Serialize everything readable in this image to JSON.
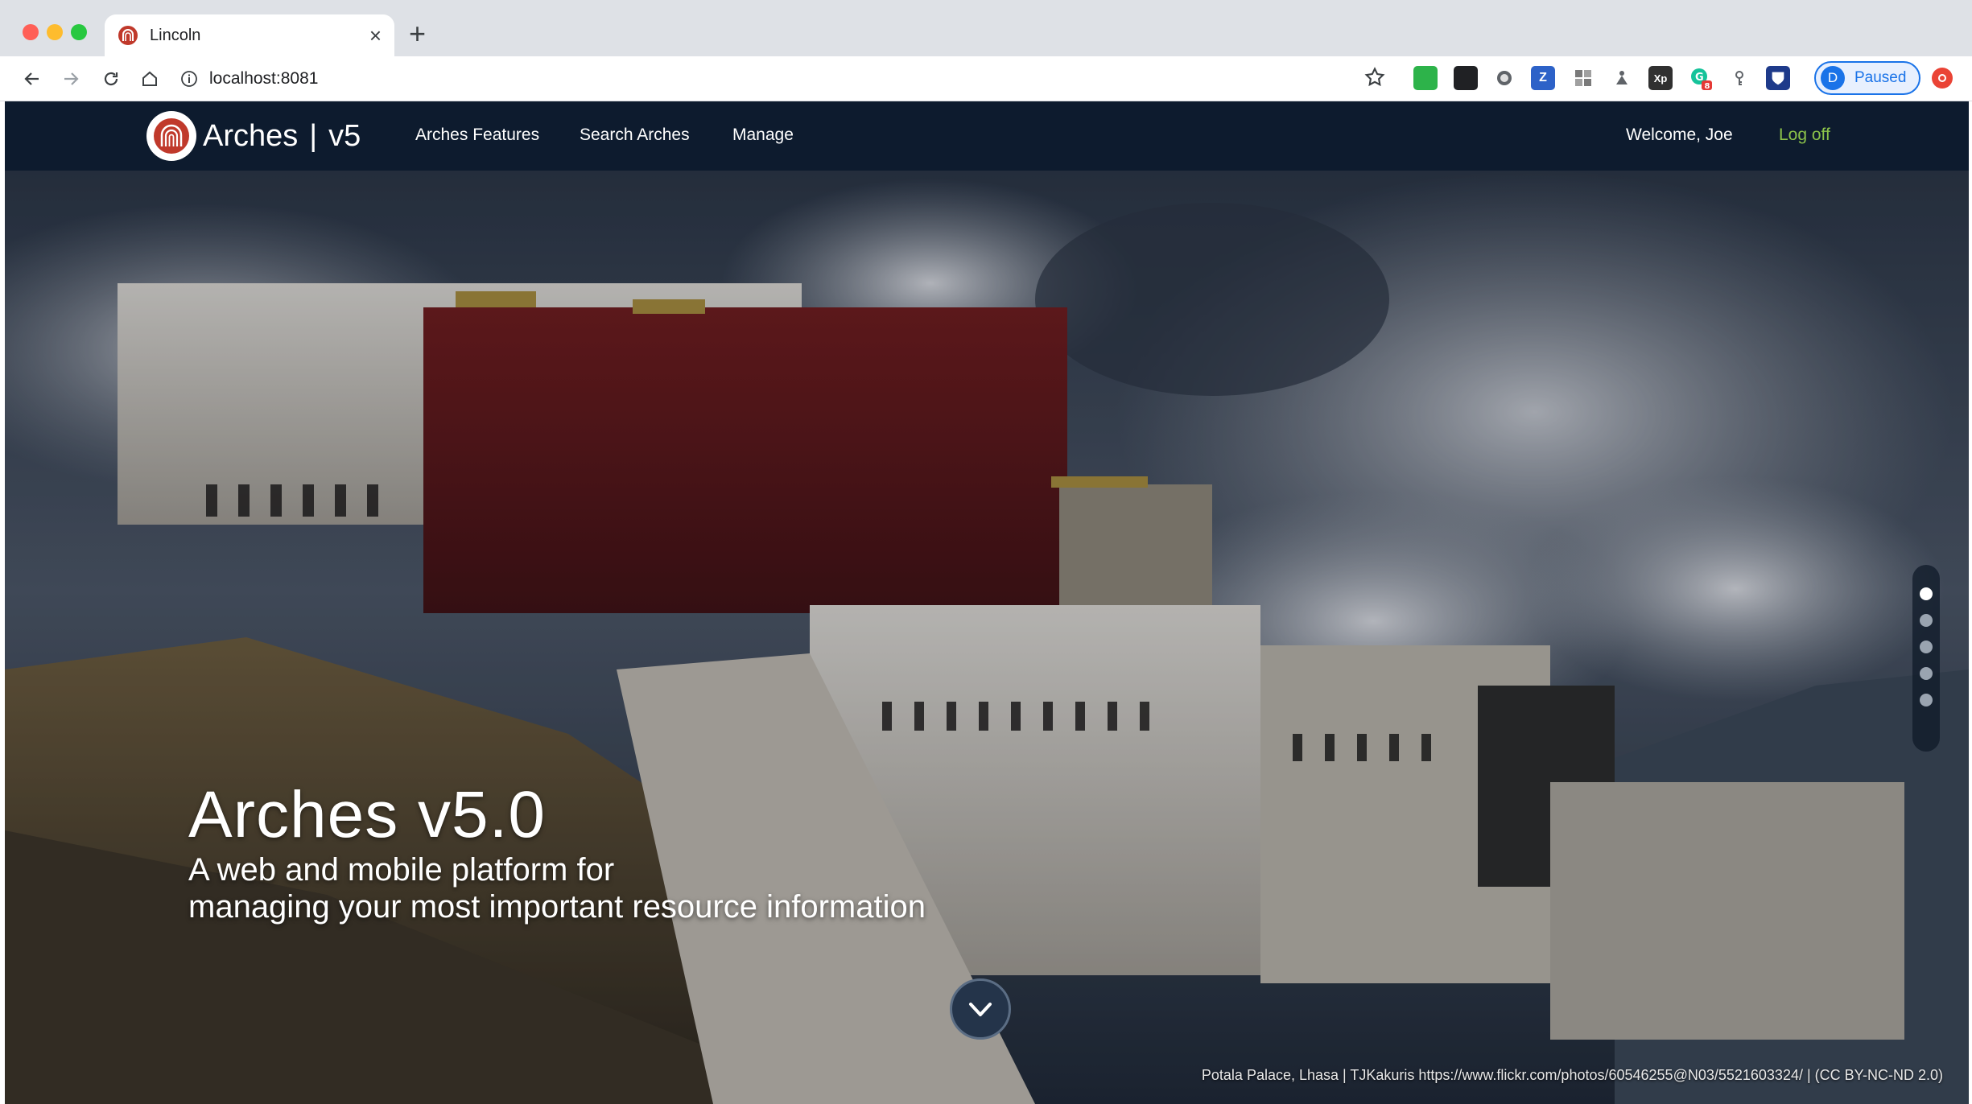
{
  "browser": {
    "tab_title": "Lincoln",
    "tab_close": "×",
    "new_tab": "+",
    "url": "localhost:8081",
    "profile_initial": "D",
    "profile_status": "Paused",
    "extension_badge": "8"
  },
  "app": {
    "brand_name": "Arches",
    "brand_separator": "|",
    "brand_version": "v5",
    "nav": {
      "features": "Arches Features",
      "search": "Search Arches",
      "manage": "Manage"
    },
    "welcome": "Welcome, Joe",
    "logoff": "Log off"
  },
  "hero": {
    "title": "Arches v5.0",
    "subtitle_line1": "A web and mobile platform for",
    "subtitle_line2": "managing your most important resource information",
    "active_slide": 1,
    "slide_count": 5,
    "credit": "Potala Palace, Lhasa | TJKakuris https://www.flickr.com/photos/60546255@N03/5521603324/ | (CC BY-NC-ND 2.0)"
  },
  "colors": {
    "app_nav_bg": "#0d1b2e",
    "logoff": "#8bc34a",
    "profile_accent": "#1a73e8"
  }
}
